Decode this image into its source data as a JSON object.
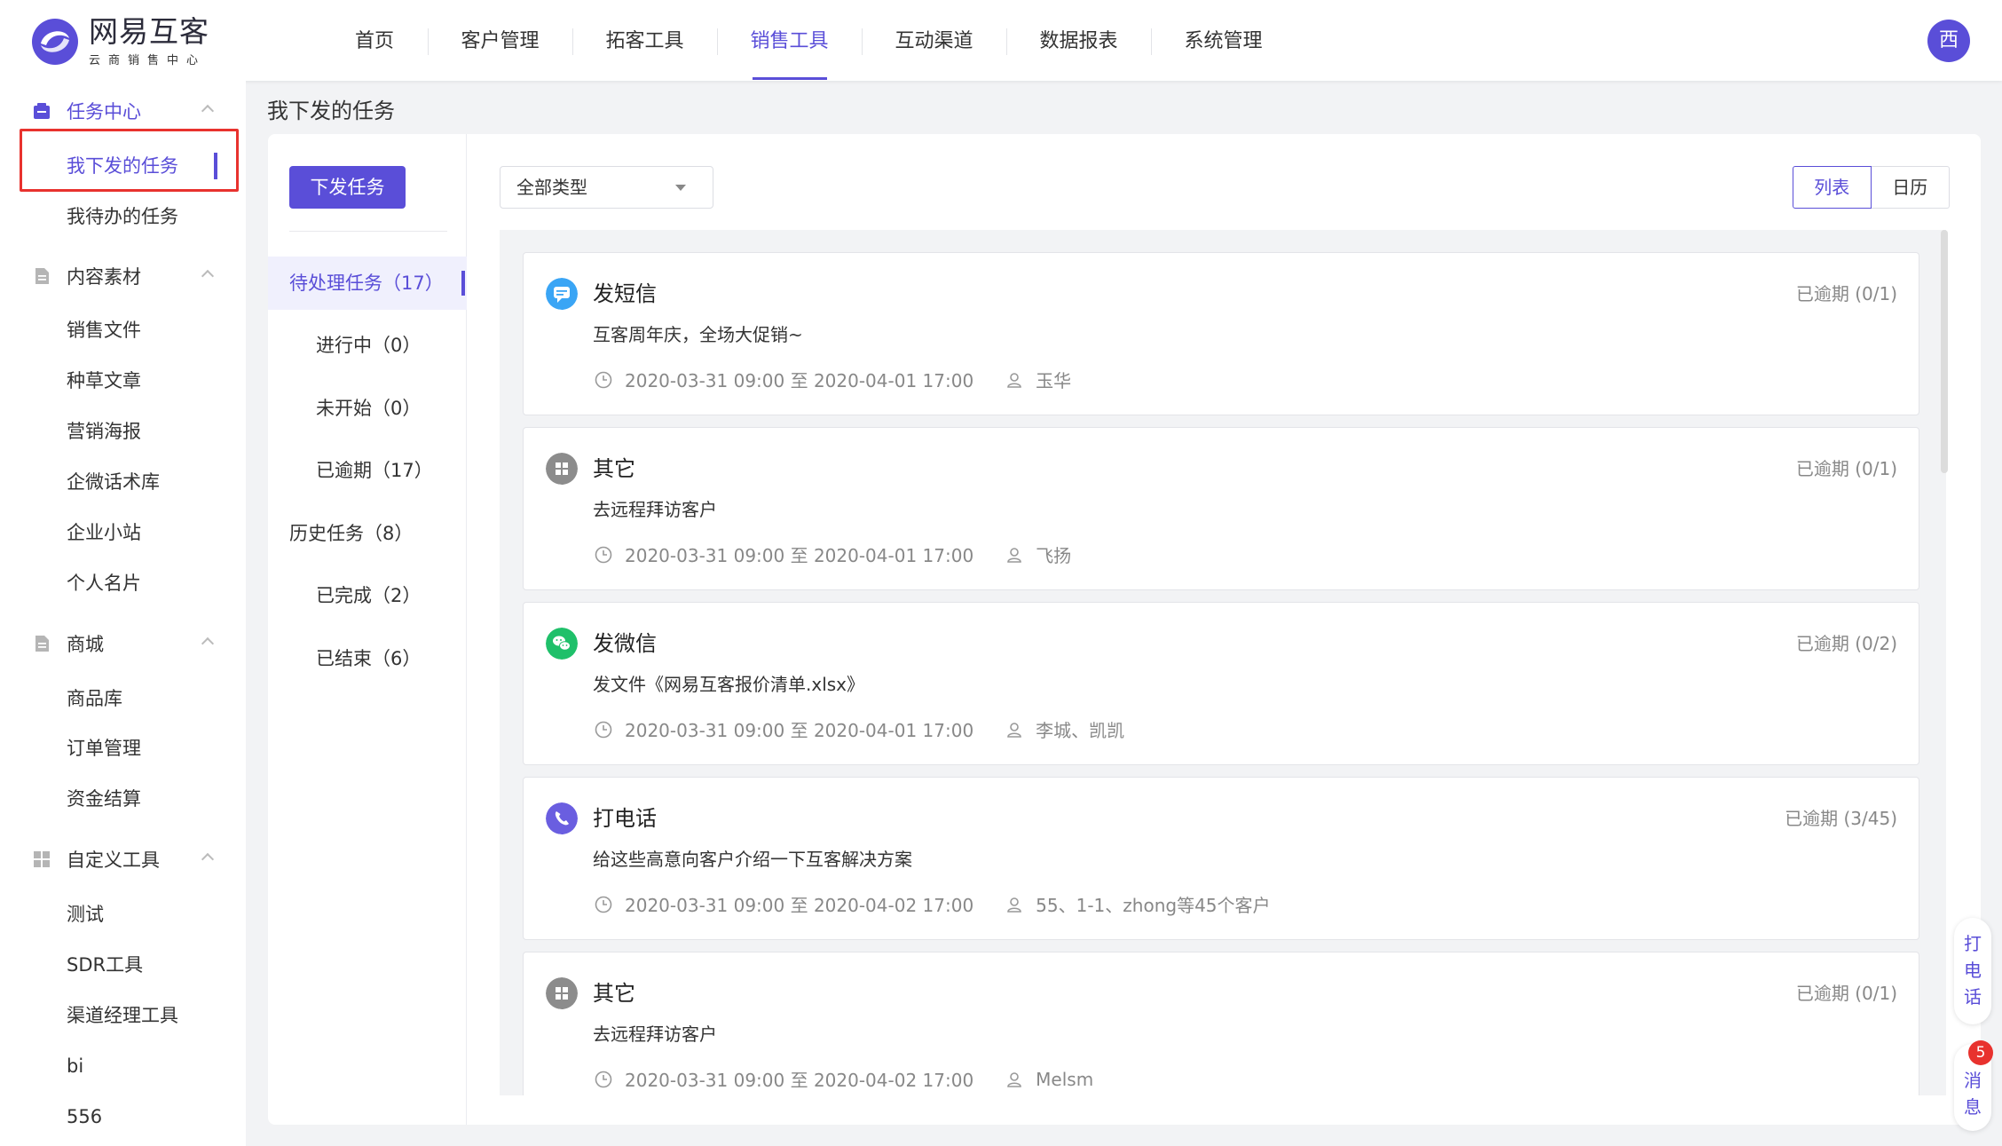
{
  "brand": {
    "name": "网易互客",
    "subtitle": "云商销售中心"
  },
  "nav": [
    {
      "label": "首页"
    },
    {
      "label": "客户管理"
    },
    {
      "label": "拓客工具"
    },
    {
      "label": "销售工具"
    },
    {
      "label": "互动渠道"
    },
    {
      "label": "数据报表"
    },
    {
      "label": "系统管理"
    }
  ],
  "nav_active_index": 3,
  "user": {
    "avatar_text": "西"
  },
  "sidebar": {
    "groups": [
      {
        "label": "任务中心",
        "icon": "task-center-icon",
        "items": [
          {
            "label": "我下发的任务"
          },
          {
            "label": "我待办的任务"
          }
        ]
      },
      {
        "label": "内容素材",
        "icon": "document-icon",
        "items": [
          {
            "label": "销售文件"
          },
          {
            "label": "种草文章"
          },
          {
            "label": "营销海报"
          },
          {
            "label": "企微话术库"
          },
          {
            "label": "企业小站"
          },
          {
            "label": "个人名片"
          }
        ]
      },
      {
        "label": "商城",
        "icon": "store-icon",
        "items": [
          {
            "label": "商品库"
          },
          {
            "label": "订单管理"
          },
          {
            "label": "资金结算"
          }
        ]
      },
      {
        "label": "自定义工具",
        "icon": "grid-icon",
        "items": [
          {
            "label": "测试"
          },
          {
            "label": "SDR工具"
          },
          {
            "label": "渠道经理工具"
          },
          {
            "label": "bi"
          },
          {
            "label": "556"
          }
        ]
      }
    ]
  },
  "page": {
    "title": "我下发的任务"
  },
  "left_panel": {
    "publish_button": "下发任务",
    "filters": [
      {
        "label": "待处理任务（17）"
      },
      {
        "label": "进行中（0）"
      },
      {
        "label": "未开始（0）"
      },
      {
        "label": "已逾期（17）"
      },
      {
        "label": "历史任务（8）"
      },
      {
        "label": "已完成（2）"
      },
      {
        "label": "已结束（6）"
      }
    ]
  },
  "toolbar": {
    "type_select": "全部类型",
    "view_list": "列表",
    "view_calendar": "日历"
  },
  "tasks": [
    {
      "type": "发短信",
      "icon": "sms-icon",
      "icon_color": "#3aa5f5",
      "desc": "互客周年庆，全场大促销~",
      "status": "已逾期 (0/1)",
      "time": "2020-03-31 09:00 至 2020-04-01 17:00",
      "assignee": "玉华"
    },
    {
      "type": "其它",
      "icon": "other-icon",
      "icon_color": "#8c8c8c",
      "desc": "去远程拜访客户",
      "status": "已逾期 (0/1)",
      "time": "2020-03-31 09:00 至 2020-04-01 17:00",
      "assignee": "飞扬"
    },
    {
      "type": "发微信",
      "icon": "wechat-icon",
      "icon_color": "#1fc06a",
      "desc": "发文件《网易互客报价清单.xlsx》",
      "status": "已逾期 (0/2)",
      "time": "2020-03-31 09:00 至 2020-04-01 17:00",
      "assignee": "李城、凯凯"
    },
    {
      "type": "打电话",
      "icon": "phone-icon",
      "icon_color": "#6a5ee0",
      "desc": "给这些高意向客户介绍一下互客解决方案",
      "status": "已逾期 (3/45)",
      "time": "2020-03-31 09:00 至 2020-04-02 17:00",
      "assignee": "55、1-1、zhong等45个客户"
    },
    {
      "type": "其它",
      "icon": "other-icon",
      "icon_color": "#8c8c8c",
      "desc": "去远程拜访客户",
      "status": "已逾期 (0/1)",
      "time": "2020-03-31 09:00 至 2020-04-02 17:00",
      "assignee": "Melsm"
    }
  ],
  "floating": {
    "call_label": "打电话",
    "message_label": "消息",
    "message_badge": "5"
  },
  "colors": {
    "accent": "#5a4ed8",
    "highlight_box": "#e8322e"
  }
}
